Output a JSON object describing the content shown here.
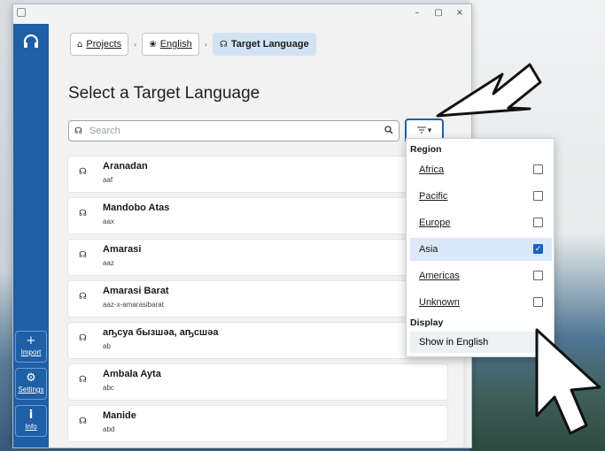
{
  "window": {
    "controls": {
      "minimize": "–",
      "maximize": "▢",
      "close": "×"
    }
  },
  "sidebar": {
    "logo_icon": "headphones-icon",
    "buttons": [
      {
        "label": "Import",
        "icon": "plus-icon",
        "glyph": "+"
      },
      {
        "label": "Settings",
        "icon": "gear-icon",
        "glyph": "⚙"
      },
      {
        "label": "Info",
        "icon": "info-icon",
        "glyph": "i"
      }
    ]
  },
  "breadcrumb": {
    "items": [
      {
        "label": "Projects",
        "icon": "home-icon",
        "glyph": "⌂"
      },
      {
        "label": "English",
        "icon": "ear-icon",
        "glyph": "❀"
      },
      {
        "label": "Target Language",
        "icon": "speaker-icon",
        "glyph": "☊"
      }
    ]
  },
  "page_title": "Select a Target Language",
  "search": {
    "placeholder": "Search",
    "value": ""
  },
  "filter_button": {
    "icon": "filter-icon"
  },
  "languages": [
    {
      "name": "Aranadan",
      "code": "aaf"
    },
    {
      "name": "Mandobo Atas",
      "code": "aax"
    },
    {
      "name": "Amarasi",
      "code": "aaz"
    },
    {
      "name": "Amarasi Barat",
      "code": "aaz-x-amarasibarat"
    },
    {
      "name": "аҧсуа бызшәа, аҧсшәа",
      "code": "ab"
    },
    {
      "name": "Ambala Ayta",
      "code": "abc"
    },
    {
      "name": "Manide",
      "code": "abd"
    }
  ],
  "dropdown": {
    "region_heading": "Region",
    "regions": [
      {
        "label": "Africa",
        "checked": false
      },
      {
        "label": "Pacific",
        "checked": false
      },
      {
        "label": "Europe",
        "checked": false
      },
      {
        "label": "Asia",
        "checked": true
      },
      {
        "label": "Americas",
        "checked": false
      },
      {
        "label": "Unknown",
        "checked": false
      }
    ],
    "display_heading": "Display",
    "display_option": "Show in English"
  },
  "colors": {
    "sidebar": "#1e5fa6",
    "accent": "#1a63c4",
    "selected_row": "#dbe8f7"
  }
}
